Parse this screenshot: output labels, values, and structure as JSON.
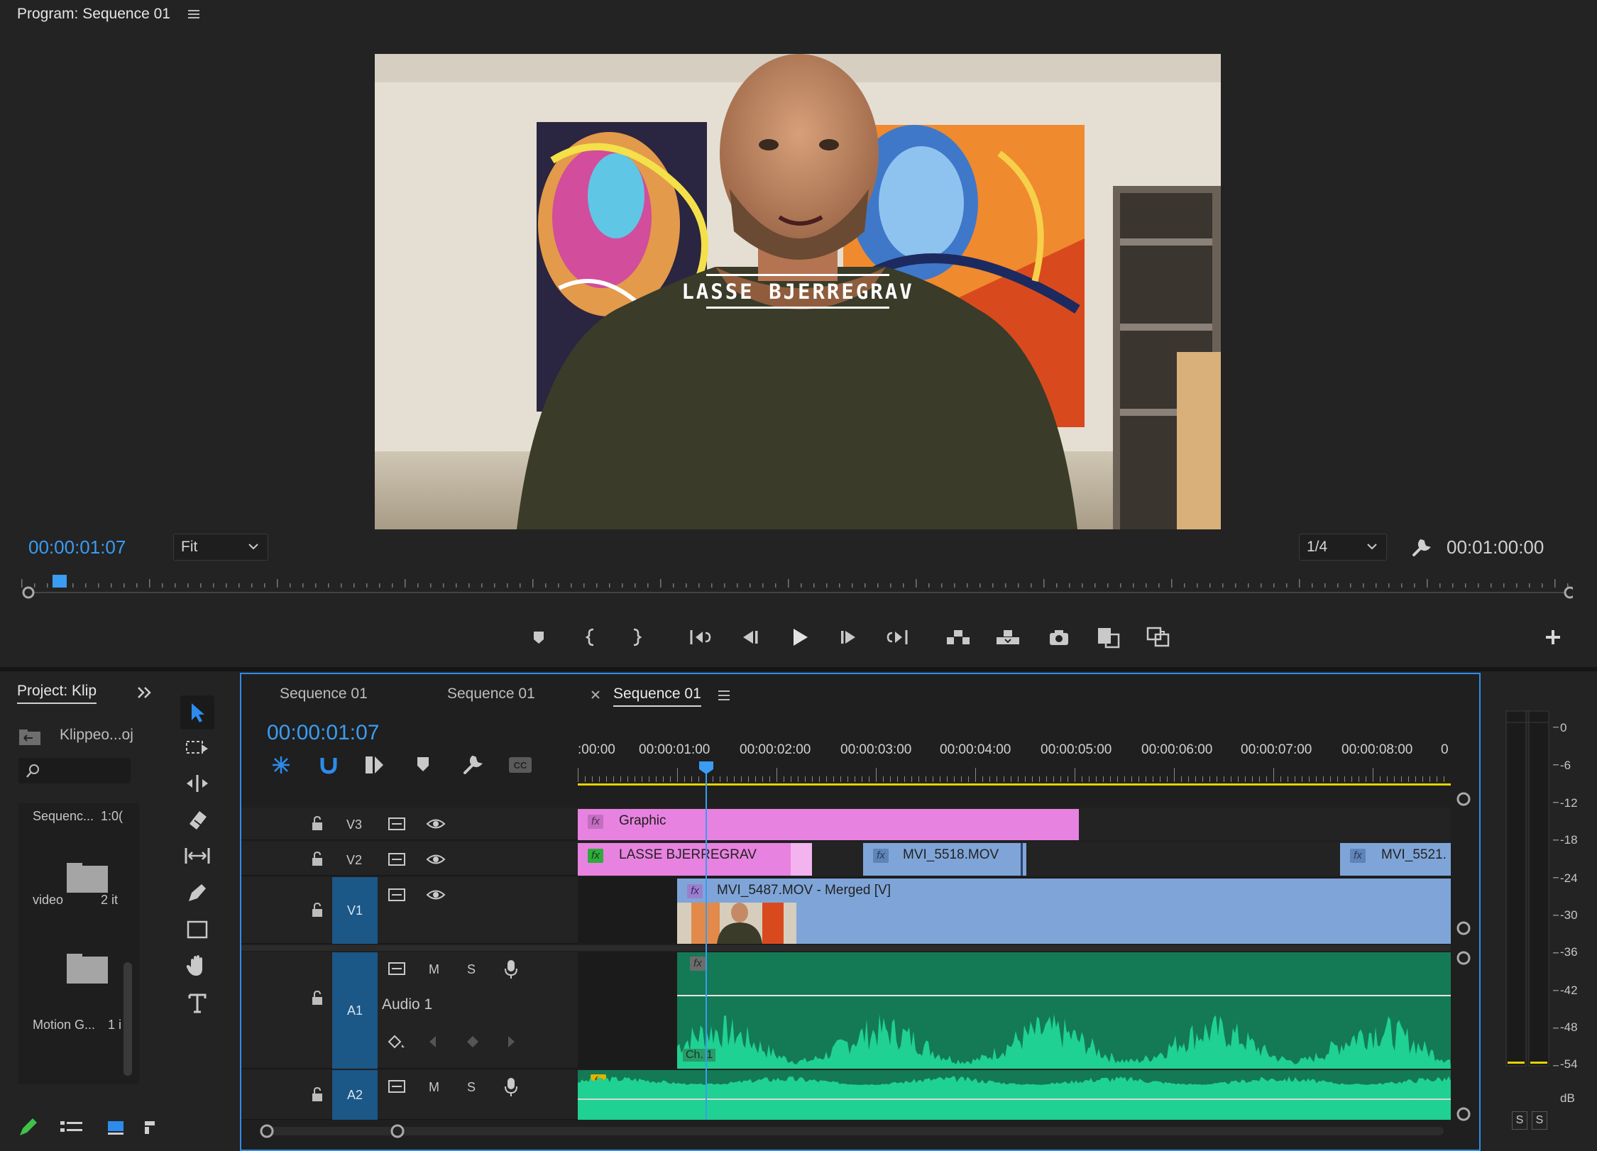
{
  "monitor": {
    "title": "Program: Sequence 01",
    "lower_third": "LASSE BJERREGRAV",
    "timecode_current": "00:00:01:07",
    "zoom_select": "Fit",
    "resolution_select": "1/4",
    "timecode_duration": "00:01:00:00",
    "transport_icons": [
      "add-marker-icon",
      "mark-in-icon",
      "mark-out-icon",
      "go-to-in-icon",
      "step-back-icon",
      "play-icon",
      "step-forward-icon",
      "go-to-out-icon",
      "lift-icon",
      "extract-icon",
      "export-frame-icon",
      "comparison-view-icon",
      "toggle-proxies-icon",
      "add-button-icon"
    ]
  },
  "project": {
    "title": "Project: Klip",
    "path": "Klippeo...oj",
    "items": [
      {
        "name": "Sequenc...",
        "meta": "1:0("
      },
      {
        "name": "video",
        "meta": "2 it"
      },
      {
        "name": "Motion G...",
        "meta": "1 i"
      }
    ]
  },
  "timeline": {
    "tabs": [
      "Sequence 01",
      "Sequence 01",
      "Sequence 01"
    ],
    "active_tab_index": 2,
    "timecode": "00:00:01:07",
    "ruler_labels": [
      ":00:00",
      "00:00:01:00",
      "00:00:02:00",
      "00:00:03:00",
      "00:00:04:00",
      "00:00:05:00",
      "00:00:06:00",
      "00:00:07:00",
      "00:00:08:00",
      "0"
    ],
    "tracks": {
      "v3": {
        "label": "V3"
      },
      "v2": {
        "label": "V2"
      },
      "v1": {
        "label": "V1"
      },
      "a1": {
        "label": "A1",
        "name": "Audio 1",
        "mute": "M",
        "solo": "S"
      },
      "a2": {
        "label": "A2",
        "mute": "M",
        "solo": "S"
      }
    },
    "clips": {
      "graphic": "Graphic",
      "lasse": "LASSE BJERREGRAV",
      "mvi5518": "MVI_5518.MOV",
      "mvi5521": "MVI_5521.",
      "mvi5487": "MVI_5487.MOV - Merged [V]",
      "channel": "Ch. 1",
      "fx": "fx"
    },
    "colors": {
      "graphic": "#e882e0",
      "video": "#7fa5d8",
      "audio": "#1fc890",
      "playhead": "#3a9cf2",
      "track_badge": "#1b5787"
    }
  },
  "meter": {
    "scale": [
      "0",
      "-6",
      "-12",
      "-18",
      "-24",
      "-30",
      "-36",
      "-42",
      "-48",
      "-54",
      "dB"
    ],
    "solo_buttons": [
      "S",
      "S"
    ]
  }
}
